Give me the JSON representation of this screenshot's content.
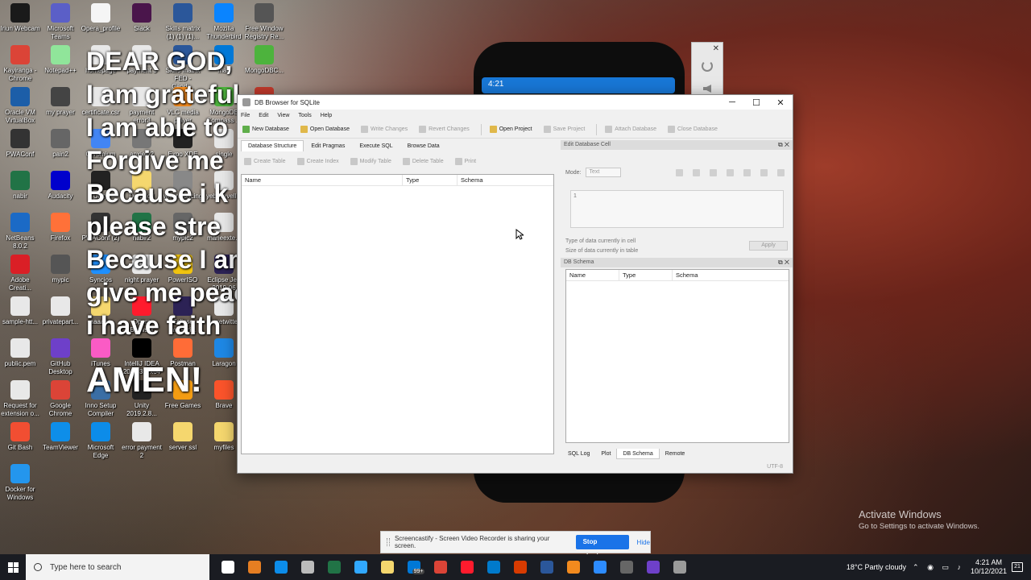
{
  "desktop_icons": [
    {
      "label": "Iriun Webcam",
      "color": "#1a1a1a"
    },
    {
      "label": "Microsoft Teams",
      "color": "#5b5fc7"
    },
    {
      "label": "Opera_profile",
      "color": "#f5f5f5"
    },
    {
      "label": "Slack",
      "color": "#4a154b"
    },
    {
      "label": "Skills matrix (1) (1) (1)...",
      "color": "#2b579a"
    },
    {
      "label": "Mozilla Thunderbird",
      "color": "#0a84ff"
    },
    {
      "label": "Free Window Registry Re...",
      "color": "#555555"
    },
    {
      "label": "Kayiranga - Chrome",
      "color": "#db4437"
    },
    {
      "label": "Notepad++",
      "color": "#90e59a"
    },
    {
      "label": "homepage",
      "color": "#e8e8e8"
    },
    {
      "label": "payment 3",
      "color": "#e8e8e8"
    },
    {
      "label": "Skills matrix FED - Candi...",
      "color": "#2b579a"
    },
    {
      "label": "map",
      "color": "#0078d7"
    },
    {
      "label": "MongoDBC...",
      "color": "#4db33d"
    },
    {
      "label": "Oracle VM VirtualBox",
      "color": "#1c5ea8"
    },
    {
      "label": "my prayer",
      "color": "#444444"
    },
    {
      "label": "certificate.csr",
      "color": "#e8e8e8"
    },
    {
      "label": "payment error3",
      "color": "#e8e8e8"
    },
    {
      "label": "VLC media player",
      "color": "#f28a1e"
    },
    {
      "label": "MongoDB Compass ...",
      "color": "#4db33d"
    },
    {
      "label": "Torch",
      "color": "#c0392b"
    },
    {
      "label": "PWAConf",
      "color": "#333333"
    },
    {
      "label": "pain2",
      "color": "#666666"
    },
    {
      "label": "Chromium",
      "color": "#4285f4"
    },
    {
      "label": "anxiety2",
      "color": "#777777"
    },
    {
      "label": "Expo XDE",
      "color": "#222222"
    },
    {
      "label": "single",
      "color": "#e8e8e8"
    },
    {
      "label": "PWAConf (1)",
      "color": "#333333"
    },
    {
      "label": "nabir",
      "color": "#217346"
    },
    {
      "label": "Audacity",
      "color": "#0000cc"
    },
    {
      "label": "Unity",
      "color": "#222222"
    },
    {
      "label": "Downlod",
      "color": "#f5d76e"
    },
    {
      "label": "willard pricing",
      "color": "#888888"
    },
    {
      "label": "yebelievell...",
      "color": "#e8e8e8"
    },
    {
      "label": "entertension",
      "color": "#e8e8e8"
    },
    {
      "label": "NetBeans 8.0.2",
      "color": "#1b6ac6"
    },
    {
      "label": "Firefox",
      "color": "#ff7139"
    },
    {
      "label": "PWAConf (2)",
      "color": "#333333"
    },
    {
      "label": "nabir2",
      "color": "#217346"
    },
    {
      "label": "mypic2",
      "color": "#666666"
    },
    {
      "label": "marieexte...",
      "color": "#e8e8e8"
    },
    {
      "label": "HTTrack Websi...",
      "color": "#333333"
    },
    {
      "label": "Adobe Creati...",
      "color": "#da1f26"
    },
    {
      "label": "mypic",
      "color": "#555555"
    },
    {
      "label": "Syncios",
      "color": "#1e90ff"
    },
    {
      "label": "night prayer",
      "color": "#e8e8e8"
    },
    {
      "label": "PowerISO",
      "color": "#f1c40f"
    },
    {
      "label": "Eclipse Jee 2019-06",
      "color": "#2c2255"
    },
    {
      "label": "Zoom",
      "color": "#2d8cff"
    },
    {
      "label": "sample-htt...",
      "color": "#e8e8e8"
    },
    {
      "label": "privatepart...",
      "color": "#e8e8e8"
    },
    {
      "label": "aaaaaa",
      "color": "#f5d76e"
    },
    {
      "label": "Opera Browser",
      "color": "#ff1b2d"
    },
    {
      "label": "Eclipse javascri...",
      "color": "#2c2255"
    },
    {
      "label": "myretwitter",
      "color": "#e8e8e8"
    },
    {
      "label": "Free Music",
      "color": "#1da1f2"
    },
    {
      "label": "public.pem",
      "color": "#e8e8e8"
    },
    {
      "label": "GitHub Desktop",
      "color": "#6e40c9"
    },
    {
      "label": "iTunes",
      "color": "#fb5bc5"
    },
    {
      "label": "IntelliJ IDEA 2018.3.3 x64",
      "color": "#000000"
    },
    {
      "label": "Postman",
      "color": "#ff6c37"
    },
    {
      "label": "Laragon",
      "color": "#1e88e5"
    },
    {
      "label": "sample-htt...",
      "color": "#e8e8e8"
    },
    {
      "label": "Request for extension o...",
      "color": "#e8e8e8"
    },
    {
      "label": "Google Chrome",
      "color": "#db4437"
    },
    {
      "label": "Inno Setup Compiler",
      "color": "#3a6ea5"
    },
    {
      "label": "Unity 2019.2.8...",
      "color": "#222222"
    },
    {
      "label": "Free Games",
      "color": "#f39c12"
    },
    {
      "label": "Brave",
      "color": "#fb542b"
    },
    {
      "label": "New folder",
      "color": "#f5d76e"
    },
    {
      "label": "Git Bash",
      "color": "#f14e32"
    },
    {
      "label": "TeamViewer",
      "color": "#0e8ee9"
    },
    {
      "label": "Microsoft Edge",
      "color": "#0c8ce9"
    },
    {
      "label": "error payment 2",
      "color": "#e8e8e8"
    },
    {
      "label": "server ssl",
      "color": "#f5d76e"
    },
    {
      "label": "myfiles",
      "color": "#f5d76e"
    },
    {
      "label": "Recycle Bin",
      "color": "#9fb8cc"
    },
    {
      "label": "Docker for Windows",
      "color": "#2496ed"
    }
  ],
  "overlay_lines": [
    "DEAR GOD,",
    "I am grateful",
    "I am able to",
    "Forgive me",
    "Because i k",
    "please stre",
    "Because I am",
    "give me peace",
    "i have faith",
    "AMEN!"
  ],
  "phone": {
    "time": "4:21"
  },
  "window": {
    "title": "DB Browser for SQLite",
    "controls": {
      "minimize": "─",
      "maximize": "☐",
      "close": "✕"
    },
    "menu": [
      "File",
      "Edit",
      "View",
      "Tools",
      "Help"
    ],
    "toolbar": {
      "new_database": "New Database",
      "open_database": "Open Database",
      "write_changes": "Write Changes",
      "revert_changes": "Revert Changes",
      "open_project": "Open Project",
      "save_project": "Save Project",
      "attach_database": "Attach Database",
      "close_database": "Close Database"
    },
    "tabs": [
      "Database Structure",
      "Edit Pragmas",
      "Execute SQL",
      "Browse Data"
    ],
    "subtoolbar": {
      "create_table": "Create Table",
      "create_index": "Create Index",
      "modify_table": "Modify Table",
      "delete_table": "Delete Table",
      "print": "Print"
    },
    "structure_columns": [
      "Name",
      "Type",
      "Schema"
    ],
    "edit_cell": {
      "title": "Edit Database Cell",
      "mode_label": "Mode:",
      "mode_value": "Text",
      "cell_value": "1",
      "type_info": "Type of data currently in cell",
      "size_info": "Size of data currently in table",
      "apply": "Apply"
    },
    "db_schema": {
      "title": "DB Schema",
      "columns": [
        "Name",
        "Type",
        "Schema"
      ]
    },
    "dock_buttons": "⧉ ✕",
    "bottom_tabs": [
      "SQL Log",
      "Plot",
      "DB Schema",
      "Remote"
    ],
    "encoding": "UTF-8"
  },
  "activate": {
    "title": "Activate Windows",
    "subtitle": "Go to Settings to activate Windows."
  },
  "share_bar": {
    "message": "Screencastify - Screen Video Recorder is sharing your screen.",
    "stop": "Stop sharing",
    "hide": "Hide"
  },
  "taskbar": {
    "search_placeholder": "Type here to search",
    "apps": [
      {
        "name": "task-view",
        "color": "#ffffff"
      },
      {
        "name": "widgets",
        "color": "#e67e22"
      },
      {
        "name": "edge",
        "color": "#0c8ce9"
      },
      {
        "name": "store",
        "color": "#bbbbbb"
      },
      {
        "name": "excel",
        "color": "#217346"
      },
      {
        "name": "photoshop",
        "color": "#31a8ff"
      },
      {
        "name": "file-explorer",
        "color": "#f5d76e"
      },
      {
        "name": "mail",
        "color": "#0078d7"
      },
      {
        "name": "chrome",
        "color": "#db4437"
      },
      {
        "name": "opera",
        "color": "#ff1b2d"
      },
      {
        "name": "vscode",
        "color": "#007acc"
      },
      {
        "name": "office",
        "color": "#d83b01"
      },
      {
        "name": "word",
        "color": "#2b579a"
      },
      {
        "name": "vlc",
        "color": "#f28a1e"
      },
      {
        "name": "zoom",
        "color": "#2d8cff"
      },
      {
        "name": "calculator",
        "color": "#666666"
      },
      {
        "name": "github",
        "color": "#6e40c9"
      },
      {
        "name": "db-browser",
        "color": "#9a9a9a"
      }
    ],
    "mail_badge": "99+",
    "weather": "18°C  Partly cloudy",
    "clock_time": "4:21 AM",
    "clock_date": "10/12/2021",
    "notification_count": "21"
  }
}
